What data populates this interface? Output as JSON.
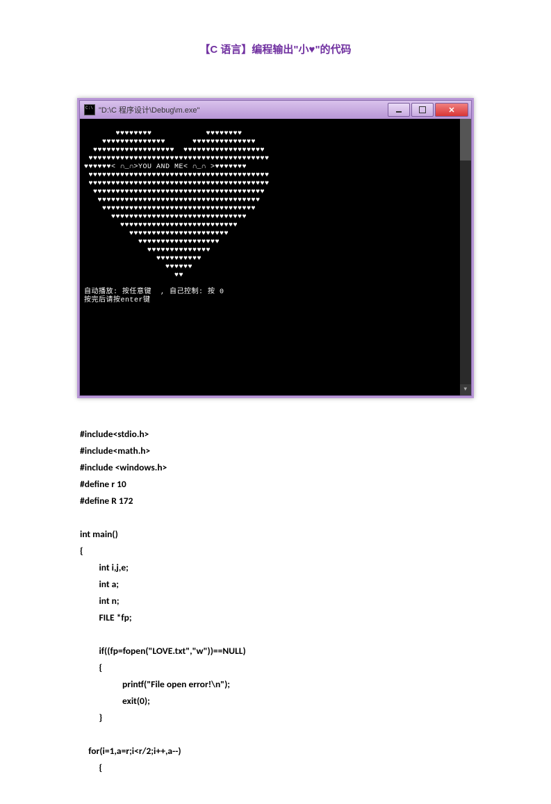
{
  "title": "【C 语言】编程输出\"小♥\"的代码",
  "window": {
    "title_text": "\"D:\\C 程序设计\\Debug\\m.exe\"",
    "buttons": {
      "minimize": "minimize",
      "maximize": "maximize",
      "close": "close"
    }
  },
  "console_output": "       ♥♥♥♥♥♥♥♥            ♥♥♥♥♥♥♥♥\n    ♥♥♥♥♥♥♥♥♥♥♥♥♥♥      ♥♥♥♥♥♥♥♥♥♥♥♥♥♥\n  ♥♥♥♥♥♥♥♥♥♥♥♥♥♥♥♥♥♥  ♥♥♥♥♥♥♥♥♥♥♥♥♥♥♥♥♥♥\n ♥♥♥♥♥♥♥♥♥♥♥♥♥♥♥♥♥♥♥♥♥♥♥♥♥♥♥♥♥♥♥♥♥♥♥♥♥♥♥♥\n♥♥♥♥♥♥< ∩_∩>YOU AND ME< ∩_∩ >♥♥♥♥♥♥♥\n ♥♥♥♥♥♥♥♥♥♥♥♥♥♥♥♥♥♥♥♥♥♥♥♥♥♥♥♥♥♥♥♥♥♥♥♥♥♥♥♥\n ♥♥♥♥♥♥♥♥♥♥♥♥♥♥♥♥♥♥♥♥♥♥♥♥♥♥♥♥♥♥♥♥♥♥♥♥♥♥♥♥\n  ♥♥♥♥♥♥♥♥♥♥♥♥♥♥♥♥♥♥♥♥♥♥♥♥♥♥♥♥♥♥♥♥♥♥♥♥♥♥\n   ♥♥♥♥♥♥♥♥♥♥♥♥♥♥♥♥♥♥♥♥♥♥♥♥♥♥♥♥♥♥♥♥♥♥♥♥\n    ♥♥♥♥♥♥♥♥♥♥♥♥♥♥♥♥♥♥♥♥♥♥♥♥♥♥♥♥♥♥♥♥♥♥\n      ♥♥♥♥♥♥♥♥♥♥♥♥♥♥♥♥♥♥♥♥♥♥♥♥♥♥♥♥♥♥\n        ♥♥♥♥♥♥♥♥♥♥♥♥♥♥♥♥♥♥♥♥♥♥♥♥♥♥\n          ♥♥♥♥♥♥♥♥♥♥♥♥♥♥♥♥♥♥♥♥♥♥\n            ♥♥♥♥♥♥♥♥♥♥♥♥♥♥♥♥♥♥\n              ♥♥♥♥♥♥♥♥♥♥♥♥♥♥\n                ♥♥♥♥♥♥♥♥♥♥\n                  ♥♥♥♥♥♥\n                    ♥♥\n\n自动播放: 按任意键  , 自己控制: 按 0\n按完后请按enter键",
  "code": "#include<stdio.h>\n#include<math.h>\n#include <windows.h>\n#define r 10\n#define R 172\n\nint main()\n{\n         int i,j,e;\n         int a;\n         int n;\n         FILE *fp;\n\n         if((fp=fopen(\"LOVE.txt\",\"w\"))==NULL)\n         {\n                    printf(\"File open error!\\n\");\n                    exit(0);\n         }\n\n    for(i=1,a=r;i<r/2;i++,a--)\n         {"
}
